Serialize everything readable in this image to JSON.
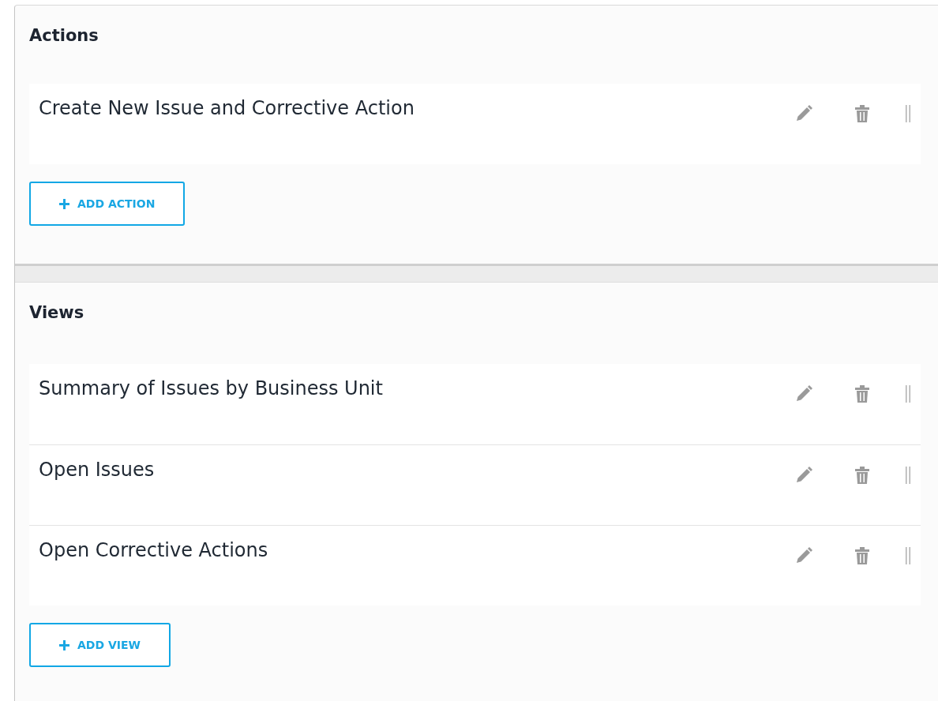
{
  "sections": [
    {
      "title": "Actions",
      "items": [
        {
          "label": "Create New Issue and Corrective Action"
        }
      ],
      "add_button": "ADD ACTION"
    },
    {
      "title": "Views",
      "items": [
        {
          "label": "Summary of Issues by Business Unit"
        },
        {
          "label": "Open Issues"
        },
        {
          "label": "Open Corrective Actions"
        }
      ],
      "add_button": "ADD VIEW"
    }
  ]
}
